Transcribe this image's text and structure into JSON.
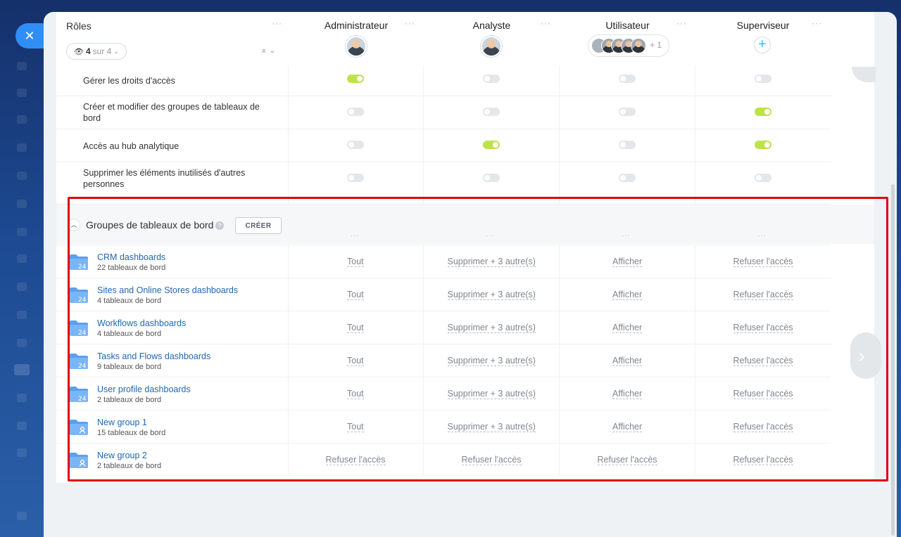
{
  "roles_panel": {
    "title": "Rôles",
    "filter_count": "4",
    "filter_suffix": "sur 4"
  },
  "roles": [
    {
      "name": "Administrateur"
    },
    {
      "name": "Analyste"
    },
    {
      "name": "Utilisateur",
      "extra_count": "+ 1"
    },
    {
      "name": "Superviseur"
    }
  ],
  "permissions": [
    {
      "label": "Gérer les droits d'accès",
      "values": [
        true,
        false,
        false,
        false
      ]
    },
    {
      "label": "Créer et modifier des groupes de tableaux de bord",
      "values": [
        false,
        false,
        false,
        true
      ]
    },
    {
      "label": "Accès au hub analytique",
      "values": [
        false,
        true,
        false,
        true
      ]
    },
    {
      "label": "Supprimer les éléments inutilisés d'autres personnes",
      "values": [
        false,
        false,
        false,
        false
      ]
    }
  ],
  "groups_section": {
    "title": "Groupes de tableaux de bord",
    "create_label": "CRÉER"
  },
  "groups": [
    {
      "name": "CRM dashboards",
      "count": "22 tableaux de bord",
      "icon": "folder-24-icon",
      "perms": [
        "Tout",
        "Supprimer + 3 autre(s)",
        "Afficher",
        "Refuser l'accès"
      ]
    },
    {
      "name": "Sites and Online Stores dashboards",
      "count": "4 tableaux de bord",
      "icon": "folder-24-icon",
      "perms": [
        "Tout",
        "Supprimer + 3 autre(s)",
        "Afficher",
        "Refuser l'accès"
      ]
    },
    {
      "name": "Workflows dashboards",
      "count": "4 tableaux de bord",
      "icon": "folder-24-icon",
      "perms": [
        "Tout",
        "Supprimer + 3 autre(s)",
        "Afficher",
        "Refuser l'accès"
      ]
    },
    {
      "name": "Tasks and Flows dashboards",
      "count": "9 tableaux de bord",
      "icon": "folder-24-icon",
      "perms": [
        "Tout",
        "Supprimer + 3 autre(s)",
        "Afficher",
        "Refuser l'accès"
      ]
    },
    {
      "name": "User profile dashboards",
      "count": "2 tableaux de bord",
      "icon": "folder-24-icon",
      "perms": [
        "Tout",
        "Supprimer + 3 autre(s)",
        "Afficher",
        "Refuser l'accès"
      ]
    },
    {
      "name": "New group 1",
      "count": "15 tableaux de bord",
      "icon": "folder-user-icon",
      "perms": [
        "Tout",
        "Supprimer + 3 autre(s)",
        "Afficher",
        "Refuser l'accès"
      ]
    },
    {
      "name": "New group 2",
      "count": "2 tableaux de bord",
      "icon": "folder-user-icon",
      "perms": [
        "Refuser l'accès",
        "Refuser l'accès",
        "Refuser l'accès",
        "Refuser l'accès"
      ]
    }
  ],
  "colors": {
    "toggle_on": "#bde34a",
    "toggle_off": "#e4e7ea",
    "link": "#2067b0",
    "highlight": "#e0000f",
    "close_button": "#2f8ef5"
  }
}
